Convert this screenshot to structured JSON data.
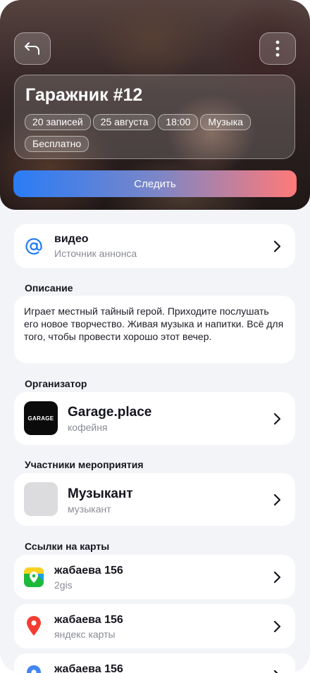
{
  "event": {
    "title": "Гаражник #12",
    "chips": [
      "20 записей",
      "25 августа",
      "18:00",
      "Музыка",
      "Бесплатно"
    ],
    "follow_label": "Следить"
  },
  "source": {
    "title": "видео",
    "subtitle": "Источник аннонса",
    "icon": "at-icon"
  },
  "description": {
    "label": "Описание",
    "text": "Играет местный тайный герой. Приходите послушать его новое творчество. Живая музыка и напитки. Всё для того, чтобы провести хорошо этот вечер."
  },
  "organizer": {
    "label": "Организатор",
    "name": "Garage.place",
    "type": "кофейня",
    "logo_text": "GARAGE"
  },
  "participants": {
    "label": "Участники мероприятия",
    "items": [
      {
        "name": "Музыкант",
        "role": "музыкант"
      }
    ]
  },
  "maps": {
    "label": "Ссылки на карты",
    "items": [
      {
        "address": "жабаева 156",
        "service": "2gis",
        "icon": "2gis-icon"
      },
      {
        "address": "жабаева 156",
        "service": "яндекс карты",
        "icon": "yandex-maps-pin-icon"
      },
      {
        "address": "жабаева 156",
        "service": "",
        "icon": "google-maps-pin-icon"
      }
    ]
  },
  "colors": {
    "accent_blue": "#2a7cf6",
    "accent_red": "#ff7a78",
    "background": "#f2f4f8"
  }
}
